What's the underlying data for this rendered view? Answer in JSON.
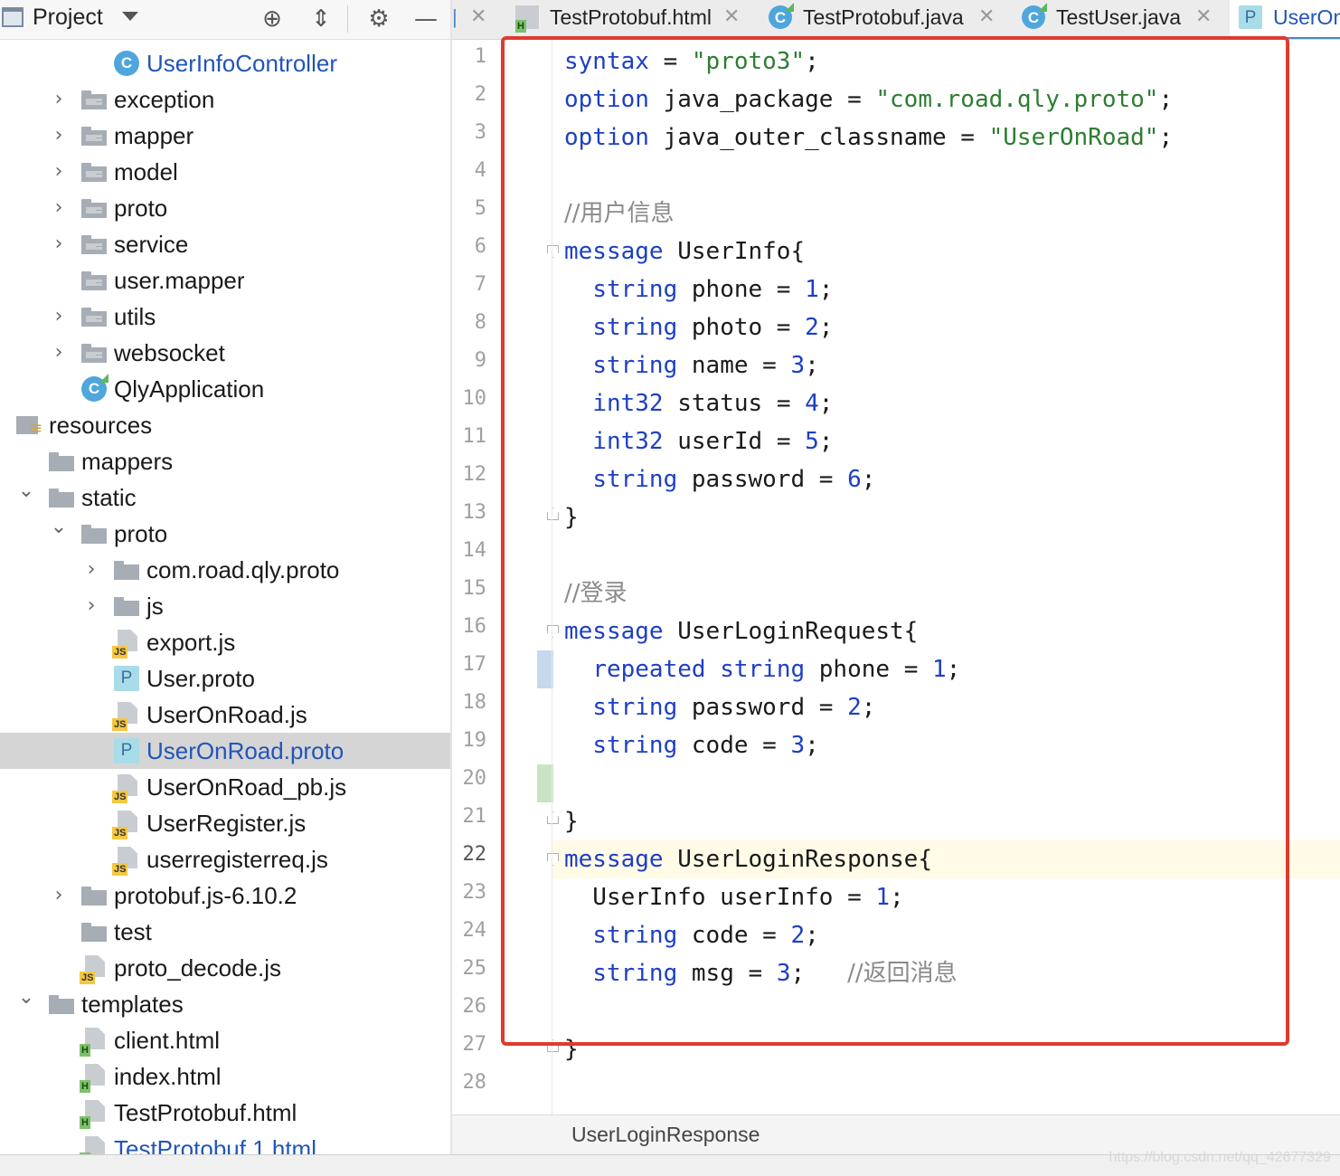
{
  "project_panel": {
    "title": "Project",
    "toolbar_icons": [
      "locate-icon",
      "collapse-all-icon",
      "gear-icon",
      "minimize-icon"
    ],
    "tree": [
      {
        "label": "UserInfoController",
        "icon": "java-class-icon",
        "arrow": "",
        "blue": true
      },
      {
        "label": "exception",
        "icon": "package-folder-icon",
        "arrow": "collapsed"
      },
      {
        "label": "mapper",
        "icon": "package-folder-icon",
        "arrow": "collapsed"
      },
      {
        "label": "model",
        "icon": "package-folder-icon",
        "arrow": "collapsed"
      },
      {
        "label": "proto",
        "icon": "package-folder-icon",
        "arrow": "collapsed"
      },
      {
        "label": "service",
        "icon": "package-folder-icon",
        "arrow": "collapsed"
      },
      {
        "label": "user.mapper",
        "icon": "package-folder-icon",
        "arrow": ""
      },
      {
        "label": "utils",
        "icon": "package-folder-icon",
        "arrow": "collapsed"
      },
      {
        "label": "websocket",
        "icon": "package-folder-icon",
        "arrow": "collapsed"
      },
      {
        "label": "QlyApplication",
        "icon": "spring-app-icon",
        "arrow": ""
      },
      {
        "label": "resources",
        "icon": "resources-folder-icon",
        "arrow": ""
      },
      {
        "label": "mappers",
        "icon": "folder-icon",
        "arrow": ""
      },
      {
        "label": "static",
        "icon": "folder-icon",
        "arrow": "expanded"
      },
      {
        "label": "proto",
        "icon": "folder-icon",
        "arrow": "expanded"
      },
      {
        "label": "com.road.qly.proto",
        "icon": "folder-icon",
        "arrow": "collapsed"
      },
      {
        "label": "js",
        "icon": "folder-icon",
        "arrow": "collapsed"
      },
      {
        "label": "export.js",
        "icon": "js-file-icon",
        "arrow": ""
      },
      {
        "label": "User.proto",
        "icon": "proto-file-icon",
        "arrow": ""
      },
      {
        "label": "UserOnRoad.js",
        "icon": "js-file-icon",
        "arrow": ""
      },
      {
        "label": "UserOnRoad.proto",
        "icon": "proto-file-icon",
        "arrow": "",
        "blue": true,
        "selected": true
      },
      {
        "label": "UserOnRoad_pb.js",
        "icon": "js-file-icon",
        "arrow": ""
      },
      {
        "label": "UserRegister.js",
        "icon": "js-file-icon",
        "arrow": ""
      },
      {
        "label": "userregisterreq.js",
        "icon": "js-file-icon",
        "arrow": ""
      },
      {
        "label": "protobuf.js-6.10.2",
        "icon": "folder-icon",
        "arrow": "collapsed"
      },
      {
        "label": "test",
        "icon": "folder-icon",
        "arrow": ""
      },
      {
        "label": "proto_decode.js",
        "icon": "js-file-icon",
        "arrow": ""
      },
      {
        "label": "templates",
        "icon": "folder-icon",
        "arrow": "expanded"
      },
      {
        "label": "client.html",
        "icon": "html-file-icon",
        "arrow": ""
      },
      {
        "label": "index.html",
        "icon": "html-file-icon",
        "arrow": ""
      },
      {
        "label": "TestProtobuf.html",
        "icon": "html-file-icon",
        "arrow": ""
      },
      {
        "label": "TestProtobuf 1.html",
        "icon": "html-file-icon",
        "arrow": "",
        "blue": true
      }
    ]
  },
  "tabs": [
    {
      "label": "TestProtobuf.html",
      "icon": "html-file-icon",
      "active": false
    },
    {
      "label": "TestProtobuf.java",
      "icon": "java-class-icon",
      "active": false
    },
    {
      "label": "TestUser.java",
      "icon": "java-class-icon",
      "active": false
    },
    {
      "label": "UserOn",
      "icon": "proto-file-icon",
      "active": true
    }
  ],
  "editor": {
    "current_line": 22,
    "lines": [
      [
        [
          "kw",
          "syntax"
        ],
        [
          "t",
          " = "
        ],
        [
          "str",
          "\"proto3\""
        ],
        [
          "t",
          ";"
        ]
      ],
      [
        [
          "kw",
          "option"
        ],
        [
          "t",
          " java_package = "
        ],
        [
          "str",
          "\"com.road.qly.proto\""
        ],
        [
          "t",
          ";"
        ]
      ],
      [
        [
          "kw",
          "option"
        ],
        [
          "t",
          " java_outer_classname = "
        ],
        [
          "str",
          "\"UserOnRoad\""
        ],
        [
          "t",
          ";"
        ]
      ],
      [],
      [
        [
          "cmt",
          "//用户信息"
        ]
      ],
      [
        [
          "kw",
          "message"
        ],
        [
          "t",
          " UserInfo{"
        ]
      ],
      [
        [
          "t",
          "  "
        ],
        [
          "kw",
          "string"
        ],
        [
          "t",
          " phone = "
        ],
        [
          "num",
          "1"
        ],
        [
          "t",
          ";"
        ]
      ],
      [
        [
          "t",
          "  "
        ],
        [
          "kw",
          "string"
        ],
        [
          "t",
          " photo = "
        ],
        [
          "num",
          "2"
        ],
        [
          "t",
          ";"
        ]
      ],
      [
        [
          "t",
          "  "
        ],
        [
          "kw",
          "string"
        ],
        [
          "t",
          " name = "
        ],
        [
          "num",
          "3"
        ],
        [
          "t",
          ";"
        ]
      ],
      [
        [
          "t",
          "  "
        ],
        [
          "kw",
          "int32"
        ],
        [
          "t",
          " status = "
        ],
        [
          "num",
          "4"
        ],
        [
          "t",
          ";"
        ]
      ],
      [
        [
          "t",
          "  "
        ],
        [
          "kw",
          "int32"
        ],
        [
          "t",
          " userId = "
        ],
        [
          "num",
          "5"
        ],
        [
          "t",
          ";"
        ]
      ],
      [
        [
          "t",
          "  "
        ],
        [
          "kw",
          "string"
        ],
        [
          "t",
          " password = "
        ],
        [
          "num",
          "6"
        ],
        [
          "t",
          ";"
        ]
      ],
      [
        [
          "t",
          "}"
        ]
      ],
      [],
      [
        [
          "cmt",
          "//登录"
        ]
      ],
      [
        [
          "kw",
          "message"
        ],
        [
          "t",
          " UserLoginRequest{"
        ]
      ],
      [
        [
          "t",
          "  "
        ],
        [
          "kw",
          "repeated"
        ],
        [
          "t",
          " "
        ],
        [
          "kw",
          "string"
        ],
        [
          "t",
          " phone = "
        ],
        [
          "num",
          "1"
        ],
        [
          "t",
          ";"
        ]
      ],
      [
        [
          "t",
          "  "
        ],
        [
          "kw",
          "string"
        ],
        [
          "t",
          " password = "
        ],
        [
          "num",
          "2"
        ],
        [
          "t",
          ";"
        ]
      ],
      [
        [
          "t",
          "  "
        ],
        [
          "kw",
          "string"
        ],
        [
          "t",
          " code = "
        ],
        [
          "num",
          "3"
        ],
        [
          "t",
          ";"
        ]
      ],
      [],
      [
        [
          "t",
          "}"
        ]
      ],
      [
        [
          "kw",
          "message"
        ],
        [
          "t",
          " UserLoginResponse{"
        ]
      ],
      [
        [
          "t",
          "  UserInfo userInfo = "
        ],
        [
          "num",
          "1"
        ],
        [
          "t",
          ";"
        ]
      ],
      [
        [
          "t",
          "  "
        ],
        [
          "kw",
          "string"
        ],
        [
          "t",
          " code = "
        ],
        [
          "num",
          "2"
        ],
        [
          "t",
          ";"
        ]
      ],
      [
        [
          "t",
          "  "
        ],
        [
          "kw",
          "string"
        ],
        [
          "t",
          " msg = "
        ],
        [
          "num",
          "3"
        ],
        [
          "t",
          ";   "
        ],
        [
          "cmt",
          "//返回消息"
        ]
      ],
      [],
      [
        [
          "t",
          "}"
        ]
      ],
      []
    ],
    "fold_markers": {
      "6": "open",
      "13": "close",
      "16": "open",
      "21": "close",
      "22": "open",
      "27": "close"
    },
    "change_markers": {
      "17": "modified",
      "20": "added"
    },
    "colors": {
      "keyword": "#1d3fc4",
      "string": "#2e7d32",
      "comment": "#8a8a8a",
      "annotation": "#e03a2f",
      "modified": "#c6d9ec",
      "added": "#c9e4c4"
    }
  },
  "breadcrumb": "UserLoginResponse",
  "watermark": "https://blog.csdn.net/qq_42677329"
}
